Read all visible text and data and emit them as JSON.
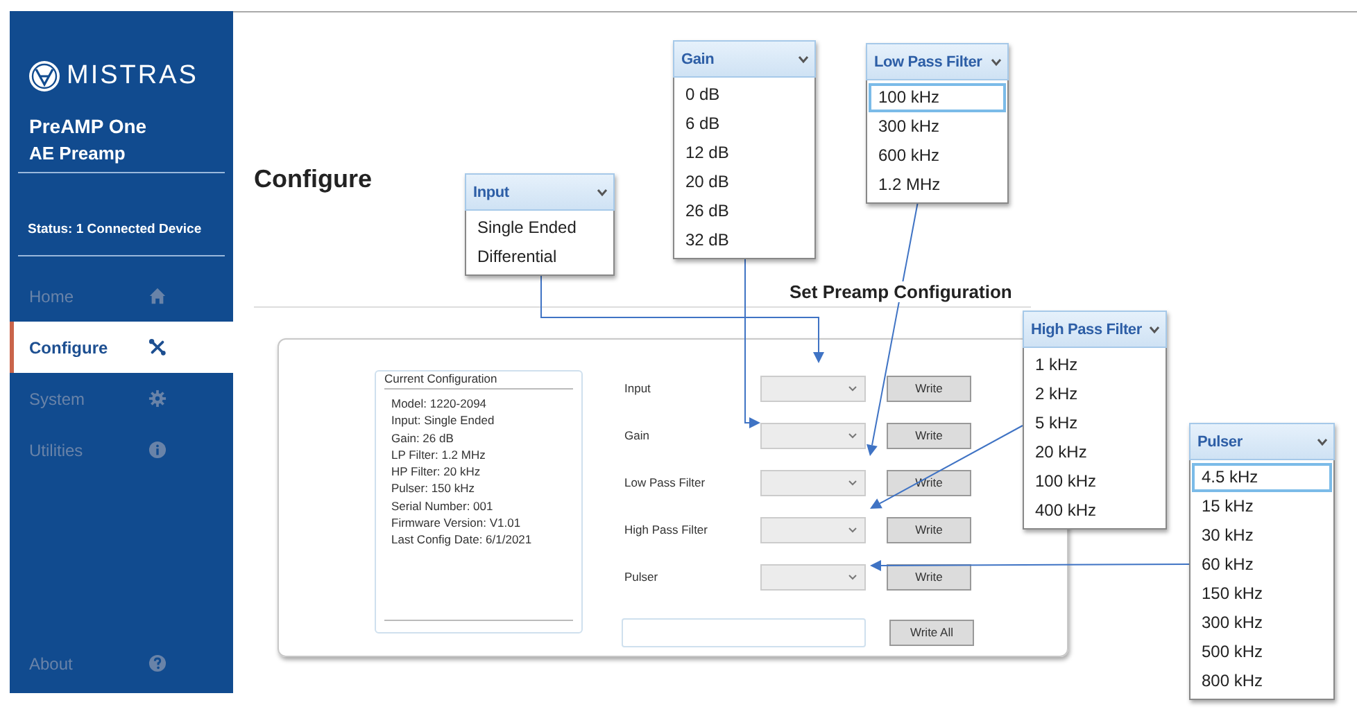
{
  "sidebar": {
    "brand": "MISTRAS",
    "product": "PreAMP One",
    "subtitle": "AE Preamp",
    "status": "Status: 1 Connected Device",
    "items": [
      {
        "label": "Home",
        "kind": "home",
        "selected": false
      },
      {
        "label": "Configure",
        "kind": "tools",
        "selected": true
      },
      {
        "label": "System",
        "kind": "gear",
        "selected": false
      },
      {
        "label": "Utilities",
        "kind": "info",
        "selected": false
      }
    ],
    "footer_item": {
      "label": "About",
      "kind": "help",
      "selected": false
    }
  },
  "page_title": "Configure",
  "section_title": "Set Preamp Configuration",
  "current_configuration": {
    "title": "Current Configuration",
    "lines": [
      "Model: 1220-2094",
      "Input: Single Ended",
      "Gain: 26 dB",
      "LP Filter: 1.2 MHz",
      "HP Filter: 20 kHz",
      "Pulser: 150 kHz",
      "Serial Number: 001",
      "Firmware Version: V1.01",
      "Last Config Date: 6/1/2021"
    ]
  },
  "settings": [
    {
      "label": "Input",
      "button": "Write"
    },
    {
      "label": "Gain",
      "button": "Write"
    },
    {
      "label": "Low Pass Filter",
      "button": "Write"
    },
    {
      "label": "High Pass Filter",
      "button": "Write"
    },
    {
      "label": "Pulser",
      "button": "Write"
    }
  ],
  "write_all": {
    "button": "Write All"
  },
  "callouts": [
    {
      "title": "Input",
      "options": [
        {
          "label": "Single Ended",
          "selected": false
        },
        {
          "label": "Differential",
          "selected": false
        }
      ]
    },
    {
      "title": "Gain",
      "options": [
        {
          "label": "0 dB",
          "selected": false
        },
        {
          "label": "6 dB",
          "selected": false
        },
        {
          "label": "12 dB",
          "selected": false
        },
        {
          "label": "20 dB",
          "selected": false
        },
        {
          "label": "26 dB",
          "selected": false
        },
        {
          "label": "32 dB",
          "selected": false
        }
      ]
    },
    {
      "title": "Low Pass Filter",
      "options": [
        {
          "label": "100 kHz",
          "selected": true
        },
        {
          "label": "300 kHz",
          "selected": false
        },
        {
          "label": "600 kHz",
          "selected": false
        },
        {
          "label": "1.2 MHz",
          "selected": false
        }
      ]
    },
    {
      "title": "High Pass Filter",
      "options": [
        {
          "label": "1 kHz",
          "selected": false
        },
        {
          "label": "2 kHz",
          "selected": false
        },
        {
          "label": "5 kHz",
          "selected": false
        },
        {
          "label": "20 kHz",
          "selected": false
        },
        {
          "label": "100 kHz",
          "selected": false
        },
        {
          "label": "400 kHz",
          "selected": false
        }
      ]
    },
    {
      "title": "Pulser",
      "options": [
        {
          "label": "4.5 kHz",
          "selected": true
        },
        {
          "label": "15 kHz",
          "selected": false
        },
        {
          "label": "30 kHz",
          "selected": false
        },
        {
          "label": "60 kHz",
          "selected": false
        },
        {
          "label": "150 kHz",
          "selected": false
        },
        {
          "label": "300 kHz",
          "selected": false
        },
        {
          "label": "500 kHz",
          "selected": false
        },
        {
          "label": "800 kHz",
          "selected": false
        }
      ]
    }
  ]
}
